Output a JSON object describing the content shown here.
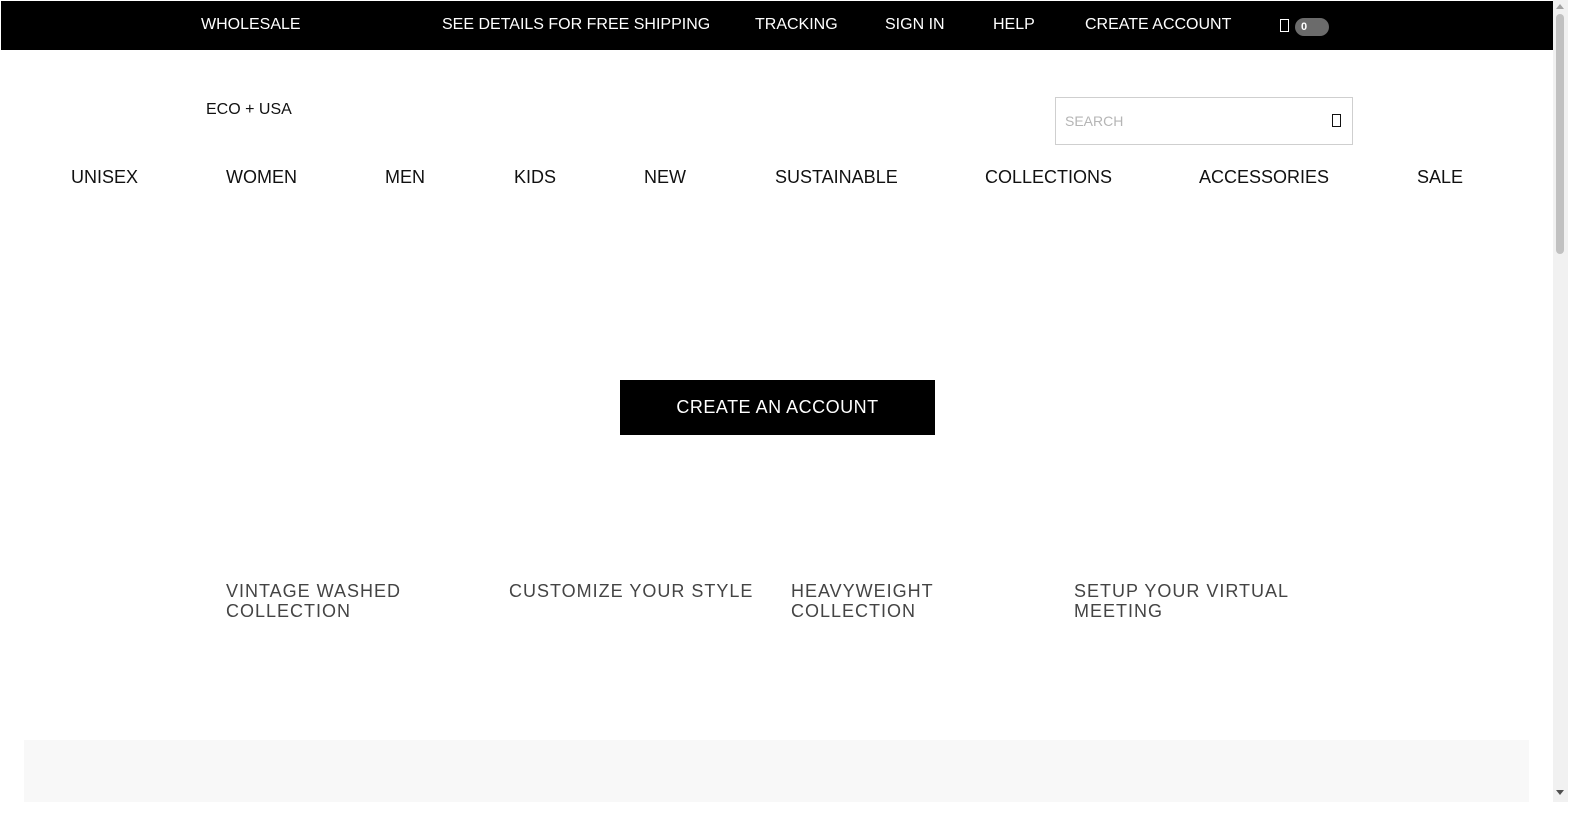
{
  "topbar": {
    "wholesale": "WHOLESALE",
    "free_shipping": "SEE DETAILS FOR FREE SHIPPING",
    "tracking": "TRACKING",
    "sign_in": "SIGN IN",
    "help": "HELP",
    "create_account": "CREATE ACCOUNT",
    "bag_count": "0",
    "bag_icon": "shopping-bag-icon"
  },
  "header": {
    "locale": "ECO + USA",
    "search": {
      "placeholder": "SEARCH",
      "icon": "search-icon"
    }
  },
  "nav": {
    "items": [
      "UNISEX",
      "WOMEN",
      "MEN",
      "KIDS",
      "NEW",
      "SUSTAINABLE",
      "COLLECTIONS",
      "ACCESSORIES",
      "SALE"
    ]
  },
  "main": {
    "cta_label": "CREATE AN ACCOUNT",
    "promos": [
      {
        "title": "VINTAGE WASHED COLLECTION"
      },
      {
        "title": "CUSTOMIZE YOUR STYLE"
      },
      {
        "title": "HEAVYWEIGHT COLLECTION"
      },
      {
        "title": "SETUP YOUR VIRTUAL MEETING"
      }
    ]
  },
  "colors": {
    "topbar_bg": "#000000",
    "cta_bg": "#000000",
    "bag_badge": "#6b6b6b",
    "promo_text": "#444444",
    "band_bg": "#f8f8f8"
  }
}
